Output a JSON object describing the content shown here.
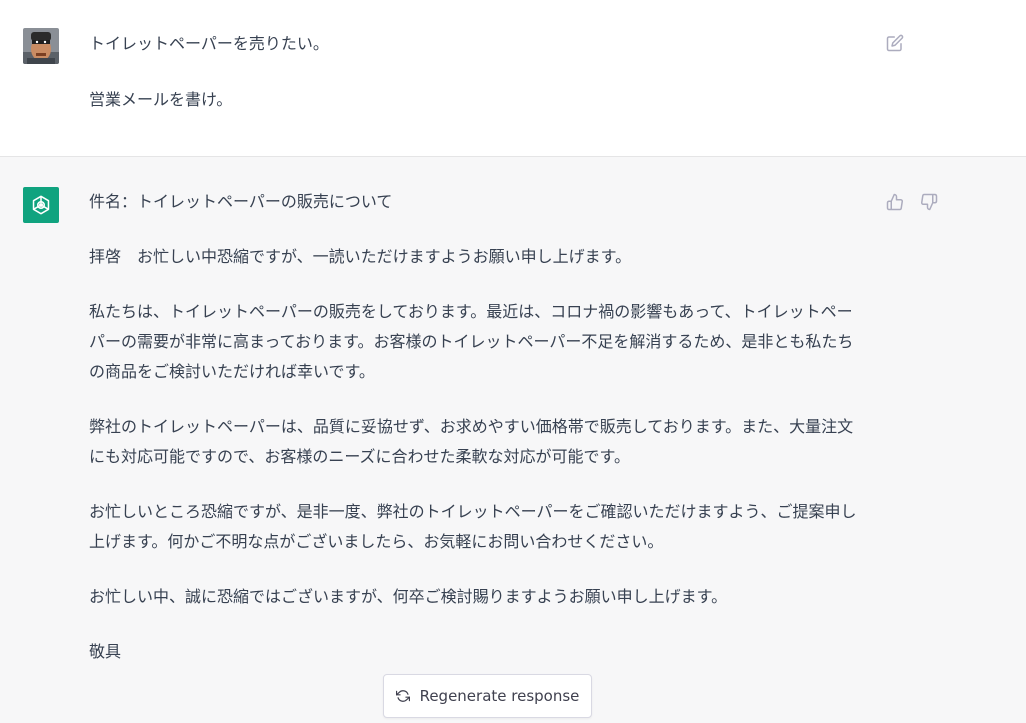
{
  "user_message": {
    "lines": [
      "トイレットペーパーを売りたい。",
      "営業メールを書け。"
    ]
  },
  "assistant_message": {
    "paragraphs": [
      "件名：トイレットペーパーの販売について",
      "拝啓　お忙しい中恐縮ですが、一読いただけますようお願い申し上げます。",
      "私たちは、トイレットペーパーの販売をしております。最近は、コロナ禍の影響もあって、トイレットペーパーの需要が非常に高まっております。お客様のトイレットペーパー不足を解消するため、是非とも私たちの商品をご検討いただければ幸いです。",
      "弊社のトイレットペーパーは、品質に妥協せず、お求めやすい価格帯で販売しております。また、大量注文にも対応可能ですので、お客様のニーズに合わせた柔軟な対応が可能です。",
      "お忙しいところ恐縮ですが、是非一度、弊社のトイレットペーパーをご確認いただけますよう、ご提案申し上げます。何かご不明な点がございましたら、お気軽にお問い合わせください。",
      "お忙しい中、誠に恐縮ではございますが、何卒ご検討賜りますようお願い申し上げます。",
      "敬具"
    ]
  },
  "controls": {
    "regenerate_label": "Regenerate response"
  },
  "icons": {
    "edit": "edit-icon",
    "thumbs_up": "thumbs-up-icon",
    "thumbs_down": "thumbs-down-icon",
    "regenerate": "refresh-icon",
    "assistant_logo": "openai-logo-icon"
  },
  "colors": {
    "assistant_bg": "#f7f7f8",
    "logo_bg": "#10a37f",
    "text": "#374151"
  }
}
